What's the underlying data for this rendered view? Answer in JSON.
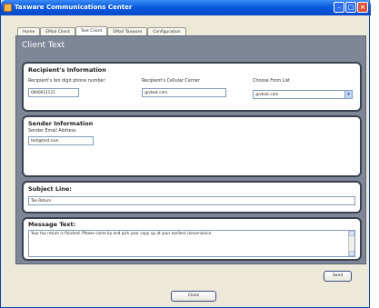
{
  "window": {
    "title": "Taxware Communications Center"
  },
  "tabs": [
    "Home",
    "EMail Client",
    "Text Client",
    "EMail Taxware",
    "Configuration"
  ],
  "active_tab": "Text Client",
  "page_heading": "Client Text",
  "recipient": {
    "title": "Recipient's Information",
    "phone_label": "Recipient's ten digit phone number",
    "phone_value": "0000012121",
    "carrier_label": "Recipient's Cellular Carrier",
    "carrier_value": "@vtext.com",
    "choose_label": "Choose From List",
    "choose_value": "@vtext.com"
  },
  "sender": {
    "title": "Sender Information",
    "email_label": "Sender Email Address",
    "email_value": "test@test.com"
  },
  "subject": {
    "title": "Subject Line:",
    "value": "Tax Return"
  },
  "message": {
    "title": "Message Text:",
    "value": "Your tax return is finished. Please come by and pick your copy up at your earliest convenience."
  },
  "buttons": {
    "send": "Send",
    "close": "Close"
  },
  "colors": {
    "panel": "#7e8797",
    "titlebar": "#0a5be0",
    "window": "#ece9d8"
  }
}
